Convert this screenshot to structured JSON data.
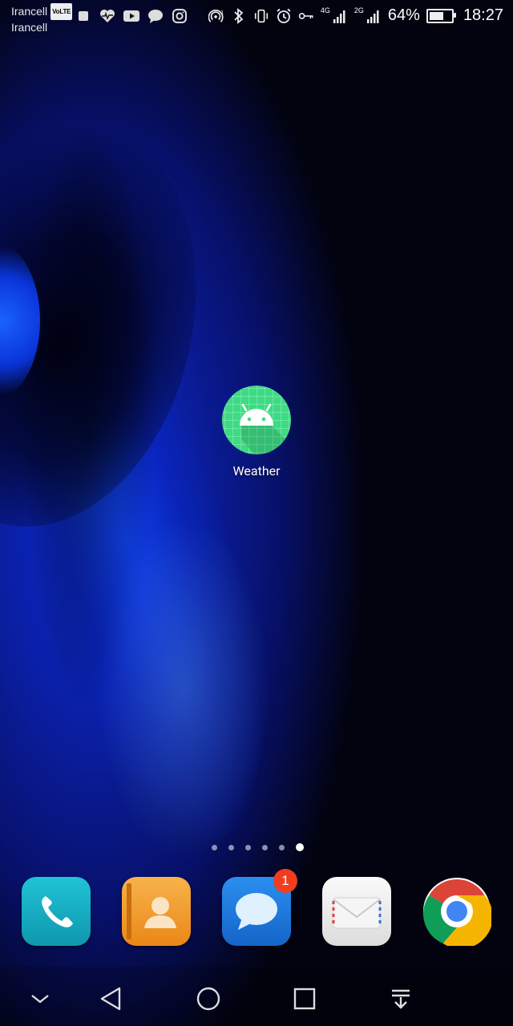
{
  "status_bar": {
    "carrier_1": "Irancell",
    "carrier_1_badge": "VoLTE",
    "carrier_2": "Irancell",
    "notification_icons": [
      "stop-icon",
      "health-icon",
      "youtube-icon",
      "chat-icon",
      "instagram-icon"
    ],
    "status_icons": [
      "hotspot-icon",
      "bluetooth-icon",
      "vibrate-icon",
      "alarm-icon",
      "key-icon"
    ],
    "network_1": "4G",
    "network_2": "2G",
    "battery_percent": "64%",
    "battery_level": 0.64,
    "time": "18:27"
  },
  "home": {
    "apps": [
      {
        "label": "Weather",
        "icon": "android-icon",
        "color": "#3ddc84"
      }
    ],
    "page_count": 6,
    "active_page": 6
  },
  "dock": {
    "items": [
      {
        "name": "phone",
        "icon": "phone-icon",
        "color": "#17b3c7"
      },
      {
        "name": "contacts",
        "icon": "contacts-icon",
        "color": "#f39a2b"
      },
      {
        "name": "messages",
        "icon": "messages-icon",
        "color": "#1e7fe0",
        "badge": "1"
      },
      {
        "name": "email",
        "icon": "email-icon",
        "color": "#efefef"
      },
      {
        "name": "chrome",
        "icon": "chrome-icon",
        "color": "#ffffff"
      }
    ]
  },
  "nav_bar": {
    "buttons": [
      "chevron-down-icon",
      "back-icon",
      "home-icon",
      "recents-icon",
      "notification-pull-icon"
    ]
  }
}
